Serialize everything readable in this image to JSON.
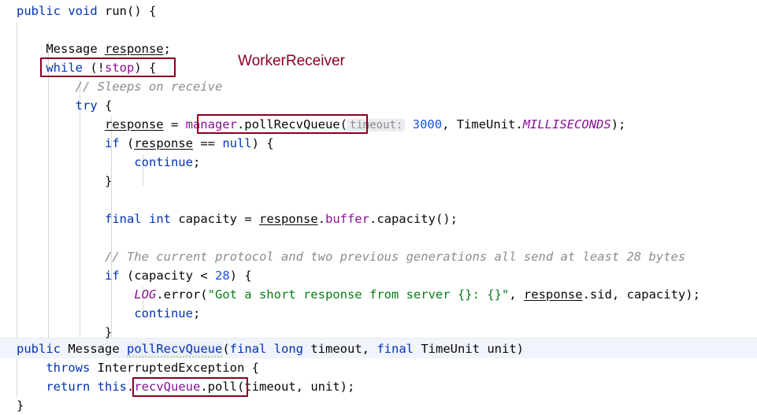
{
  "editor": {
    "language": "java",
    "background": "#ffffff",
    "accent_annotation_color": "#8b0020",
    "current_line_highlight": "#f2f4fd",
    "usage_highlight": "#eceef8"
  },
  "annotation": {
    "label": "WorkerReceiver",
    "color": "#8b0020",
    "boxes": [
      {
        "name": "while-stop-box",
        "target": "while (!stop) {"
      },
      {
        "name": "manager-pollrecvqueue-box",
        "target": "manager.pollRecvQueue("
      },
      {
        "name": "recvqueue-poll-box",
        "target": "recvQueue.poll"
      }
    ]
  },
  "fragment_top": {
    "lines": [
      {
        "n": 1,
        "text": "public void run() {",
        "tokens": [
          {
            "t": "public",
            "c": "kw"
          },
          {
            "t": " ",
            "c": "plain"
          },
          {
            "t": "void",
            "c": "kw"
          },
          {
            "t": " run() {",
            "c": "plain"
          }
        ]
      },
      {
        "n": 2,
        "text": "",
        "tokens": []
      },
      {
        "n": 3,
        "text": "    Message response;",
        "tokens": [
          {
            "t": "    Message ",
            "c": "plain"
          },
          {
            "t": "response",
            "c": "field-u"
          },
          {
            "t": ";",
            "c": "plain"
          }
        ]
      },
      {
        "n": 4,
        "text": "    while (!stop) {",
        "tokens": [
          {
            "t": "    ",
            "c": "plain"
          },
          {
            "t": "while",
            "c": "kw"
          },
          {
            "t": " (!",
            "c": "plain"
          },
          {
            "t": "stop",
            "c": "fld"
          },
          {
            "t": ") {",
            "c": "plain"
          }
        ]
      },
      {
        "n": 5,
        "text": "        // Sleeps on receive",
        "tokens": [
          {
            "t": "        ",
            "c": "plain"
          },
          {
            "t": "// Sleeps on receive",
            "c": "cmt"
          }
        ]
      },
      {
        "n": 6,
        "text": "        try {",
        "tokens": [
          {
            "t": "        ",
            "c": "plain"
          },
          {
            "t": "try",
            "c": "kw"
          },
          {
            "t": " {",
            "c": "plain"
          }
        ]
      },
      {
        "n": 7,
        "text": "            response = manager.pollRecvQueue( timeout: 3000, TimeUnit.MILLISECONDS);",
        "tokens": [
          {
            "t": "            ",
            "c": "plain"
          },
          {
            "t": "response",
            "c": "field-u"
          },
          {
            "t": " = ",
            "c": "plain"
          },
          {
            "t": "manager",
            "c": "fld"
          },
          {
            "t": ".pollRecvQueue(",
            "c": "plain"
          },
          {
            "t": "timeout:",
            "c": "hint"
          },
          {
            "t": " ",
            "c": "plain"
          },
          {
            "t": "3000",
            "c": "num"
          },
          {
            "t": ", TimeUnit.",
            "c": "plain"
          },
          {
            "t": "MILLISECONDS",
            "c": "stat"
          },
          {
            "t": ");",
            "c": "plain"
          }
        ]
      },
      {
        "n": 8,
        "text": "            if (response == null) {",
        "tokens": [
          {
            "t": "            ",
            "c": "plain"
          },
          {
            "t": "if",
            "c": "kw"
          },
          {
            "t": " (",
            "c": "plain"
          },
          {
            "t": "response",
            "c": "field-u"
          },
          {
            "t": " == ",
            "c": "plain"
          },
          {
            "t": "null",
            "c": "kw"
          },
          {
            "t": ") {",
            "c": "plain"
          }
        ]
      },
      {
        "n": 9,
        "text": "                continue;",
        "tokens": [
          {
            "t": "                ",
            "c": "plain"
          },
          {
            "t": "continue",
            "c": "kw"
          },
          {
            "t": ";",
            "c": "plain"
          }
        ]
      },
      {
        "n": 10,
        "text": "            }",
        "tokens": [
          {
            "t": "            }",
            "c": "plain"
          }
        ]
      },
      {
        "n": 11,
        "text": "",
        "tokens": []
      },
      {
        "n": 12,
        "text": "            final int capacity = response.buffer.capacity();",
        "tokens": [
          {
            "t": "            ",
            "c": "plain"
          },
          {
            "t": "final",
            "c": "kw"
          },
          {
            "t": " ",
            "c": "plain"
          },
          {
            "t": "int",
            "c": "kw"
          },
          {
            "t": " capacity = ",
            "c": "plain"
          },
          {
            "t": "response",
            "c": "field-u"
          },
          {
            "t": ".",
            "c": "plain"
          },
          {
            "t": "buffer",
            "c": "fld"
          },
          {
            "t": ".capacity();",
            "c": "plain"
          }
        ]
      },
      {
        "n": 13,
        "text": "",
        "tokens": []
      },
      {
        "n": 14,
        "text": "            // The current protocol and two previous generations all send at least 28 bytes",
        "tokens": [
          {
            "t": "            ",
            "c": "plain"
          },
          {
            "t": "// The current protocol and two previous generations all send at least 28 bytes",
            "c": "cmt"
          }
        ]
      },
      {
        "n": 15,
        "text": "            if (capacity < 28) {",
        "tokens": [
          {
            "t": "            ",
            "c": "plain"
          },
          {
            "t": "if",
            "c": "kw"
          },
          {
            "t": " (capacity < ",
            "c": "plain"
          },
          {
            "t": "28",
            "c": "num"
          },
          {
            "t": ") {",
            "c": "plain"
          }
        ]
      },
      {
        "n": 16,
        "text": "                LOG.error(\"Got a short response from server {}: {}\", response.sid, capacity);",
        "tokens": [
          {
            "t": "                ",
            "c": "plain"
          },
          {
            "t": "LOG",
            "c": "stat"
          },
          {
            "t": ".error(",
            "c": "plain"
          },
          {
            "t": "\"Got a short response from server {}: {}\"",
            "c": "str"
          },
          {
            "t": ", ",
            "c": "plain"
          },
          {
            "t": "response",
            "c": "field-u"
          },
          {
            "t": ".",
            "c": "plain"
          },
          {
            "t": "sid",
            "c": "plain"
          },
          {
            "t": ", capacity);",
            "c": "plain"
          }
        ]
      },
      {
        "n": 17,
        "text": "                continue;",
        "tokens": [
          {
            "t": "                ",
            "c": "plain"
          },
          {
            "t": "continue",
            "c": "kw"
          },
          {
            "t": ";",
            "c": "plain"
          }
        ]
      },
      {
        "n": 18,
        "text": "            }",
        "tokens": [
          {
            "t": "            }",
            "c": "plain"
          }
        ]
      }
    ]
  },
  "fragment_bottom": {
    "lines": [
      {
        "n": 1,
        "highlighted": true,
        "text": "public Message pollRecvQueue(final long timeout, final TimeUnit unit)",
        "tokens": [
          {
            "t": "public",
            "c": "kw"
          },
          {
            "t": " Message ",
            "c": "plain"
          },
          {
            "t": "pollRecvQueue",
            "c": "decl"
          },
          {
            "t": "(",
            "c": "plain"
          },
          {
            "t": "final",
            "c": "kw"
          },
          {
            "t": " ",
            "c": "plain"
          },
          {
            "t": "long",
            "c": "kw"
          },
          {
            "t": " timeout, ",
            "c": "plain"
          },
          {
            "t": "final",
            "c": "kw"
          },
          {
            "t": " TimeUnit unit)",
            "c": "plain"
          }
        ]
      },
      {
        "n": 2,
        "highlighted": false,
        "text": "    throws InterruptedException {",
        "tokens": [
          {
            "t": "    ",
            "c": "plain"
          },
          {
            "t": "throws",
            "c": "kw"
          },
          {
            "t": " InterruptedException {",
            "c": "plain"
          }
        ]
      },
      {
        "n": 3,
        "highlighted": false,
        "text": "    return this.recvQueue.poll(timeout, unit);",
        "tokens": [
          {
            "t": "    ",
            "c": "plain"
          },
          {
            "t": "return",
            "c": "kw"
          },
          {
            "t": " ",
            "c": "plain"
          },
          {
            "t": "this",
            "c": "kw"
          },
          {
            "t": ".",
            "c": "plain"
          },
          {
            "t": "recvQueue",
            "c": "fld"
          },
          {
            "t": ".poll(timeout, unit);",
            "c": "plain"
          }
        ]
      },
      {
        "n": 4,
        "highlighted": false,
        "text": "}",
        "tokens": [
          {
            "t": "}",
            "c": "plain"
          }
        ]
      }
    ]
  }
}
